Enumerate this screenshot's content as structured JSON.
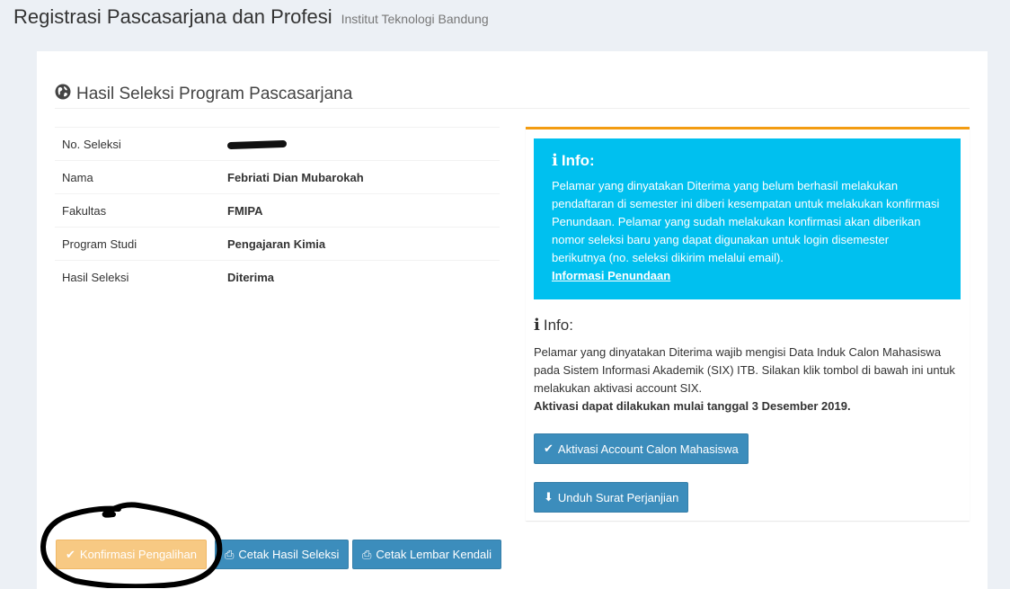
{
  "header": {
    "title": "Registrasi Pascasarjana dan Profesi",
    "subtitle": "Institut Teknologi Bandung"
  },
  "box": {
    "title": "Hasil Seleksi Program Pascasarjana",
    "title_icon": "globe-icon"
  },
  "details": [
    {
      "label": "No. Seleksi",
      "value": ""
    },
    {
      "label": "Nama",
      "value": "Febriati Dian Mubarokah"
    },
    {
      "label": "Fakultas",
      "value": "FMIPA"
    },
    {
      "label": "Program Studi",
      "value": "Pengajaran Kimia"
    },
    {
      "label": "Hasil Seleksi",
      "value": "Diterima"
    }
  ],
  "callout": {
    "title": "Info:",
    "body": "Pelamar yang dinyatakan Diterima yang belum berhasil melakukan pendaftaran di semester ini diberi kesempatan untuk melakukan konfirmasi Penundaan. Pelamar yang sudah melakukan konfirmasi akan diberikan nomor seleksi baru yang dapat digunakan untuk login disemester berikutnya (no. seleksi dikirim melalui email).",
    "link": "Informasi Penundaan"
  },
  "info2": {
    "title": "Info:",
    "body": "Pelamar yang dinyatakan Diterima wajib mengisi Data Induk Calon Mahasiswa pada Sistem Informasi Akademik (SIX) ITB. Silakan klik tombol di bawah ini untuk melakukan aktivasi account SIX.",
    "strong": "Aktivasi dapat dilakukan mulai tanggal 3 Desember 2019."
  },
  "buttons": {
    "aktivasi": "Aktivasi Account Calon Mahasiswa",
    "unduh": "Unduh Surat Perjanjian",
    "konfirmasi": "Konfirmasi Pengalihan",
    "cetak_hasil": "Cetak Hasil Seleksi",
    "cetak_lembar": "Cetak Lembar Kendali"
  },
  "colors": {
    "primary": "#3c8dbc",
    "warning": "#f39c12",
    "info": "#00c0ef"
  }
}
